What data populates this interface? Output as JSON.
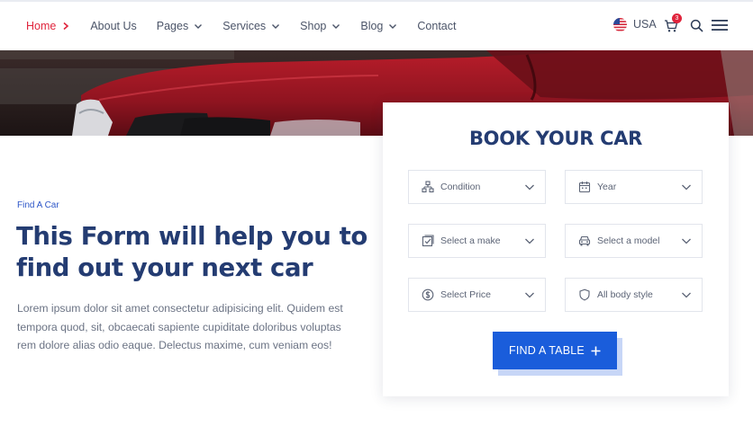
{
  "nav": {
    "items": [
      {
        "label": "Home",
        "active": true
      },
      {
        "label": "About Us"
      },
      {
        "label": "Pages"
      },
      {
        "label": "Services"
      },
      {
        "label": "Shop"
      },
      {
        "label": "Blog"
      },
      {
        "label": "Contact"
      }
    ],
    "language": "USA",
    "cart_count": "3",
    "icons": [
      "us-flag-icon",
      "cart-icon",
      "search-icon",
      "menu-icon"
    ]
  },
  "intro": {
    "eyebrow": "Find A Car",
    "headline": "This Form will help you to find out your next car",
    "paragraph": "Lorem ipsum dolor sit amet consectetur adipisicing elit. Quidem est tempora quod, sit, obcaecati sapiente cupiditate doloribus voluptas rem dolore alias odio eaque. Delectus maxime, cum veniam eos!"
  },
  "booking": {
    "title": "BOOK YOUR CAR",
    "fields": [
      {
        "label": "Condition",
        "icon": "hierarchy-icon"
      },
      {
        "label": "Year",
        "icon": "calendar-icon"
      },
      {
        "label": "Select a make",
        "icon": "checklist-icon"
      },
      {
        "label": "Select a model",
        "icon": "car-icon"
      },
      {
        "label": "Select Price",
        "icon": "dollar-icon"
      },
      {
        "label": "All body style",
        "icon": "shield-icon"
      }
    ],
    "cta": "FIND A TABLE"
  },
  "colors": {
    "accent": "#1a5ddb",
    "active": "#e0243c",
    "heading": "#243c72"
  }
}
